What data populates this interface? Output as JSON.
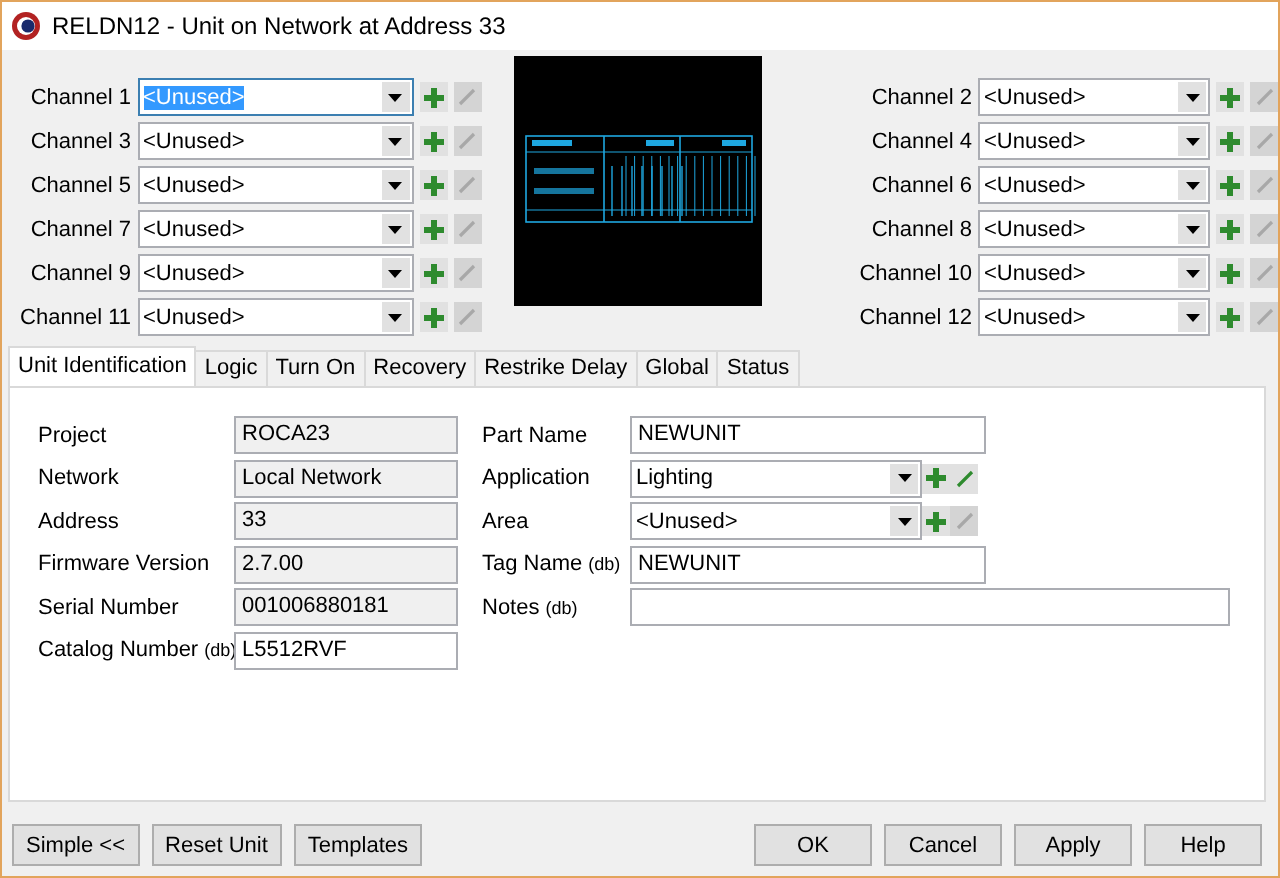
{
  "window": {
    "title": "RELDN12 - Unit on Network at Address 33"
  },
  "left_channels": [
    {
      "label": "Channel 1",
      "value": "<Unused>",
      "focused": true,
      "edit_enabled": false
    },
    {
      "label": "Channel 3",
      "value": "<Unused>",
      "focused": false,
      "edit_enabled": false
    },
    {
      "label": "Channel 5",
      "value": "<Unused>",
      "focused": false,
      "edit_enabled": false
    },
    {
      "label": "Channel 7",
      "value": "<Unused>",
      "focused": false,
      "edit_enabled": false
    },
    {
      "label": "Channel 9",
      "value": "<Unused>",
      "focused": false,
      "edit_enabled": false
    },
    {
      "label": "Channel 11",
      "value": "<Unused>",
      "focused": false,
      "edit_enabled": false
    }
  ],
  "right_channels": [
    {
      "label": "Channel 2",
      "value": "<Unused>",
      "focused": false,
      "edit_enabled": false
    },
    {
      "label": "Channel 4",
      "value": "<Unused>",
      "focused": false,
      "edit_enabled": false
    },
    {
      "label": "Channel 6",
      "value": "<Unused>",
      "focused": false,
      "edit_enabled": false
    },
    {
      "label": "Channel 8",
      "value": "<Unused>",
      "focused": false,
      "edit_enabled": false
    },
    {
      "label": "Channel 10",
      "value": "<Unused>",
      "focused": false,
      "edit_enabled": false
    },
    {
      "label": "Channel 12",
      "value": "<Unused>",
      "focused": false,
      "edit_enabled": false
    }
  ],
  "tabs": [
    {
      "label": "Unit Identification",
      "selected": true
    },
    {
      "label": "Logic",
      "selected": false
    },
    {
      "label": "Turn On",
      "selected": false
    },
    {
      "label": "Recovery",
      "selected": false
    },
    {
      "label": "Restrike Delay",
      "selected": false
    },
    {
      "label": "Global",
      "selected": false
    },
    {
      "label": "Status",
      "selected": false
    }
  ],
  "left_fields": [
    {
      "kind": "text",
      "label": "Project",
      "value": "ROCA23",
      "readonly": true
    },
    {
      "kind": "text",
      "label": "Network",
      "value": "Local Network",
      "readonly": true
    },
    {
      "kind": "text",
      "label": "Address",
      "value": "33",
      "readonly": true
    },
    {
      "kind": "text",
      "label": "Firmware Version",
      "value": "2.7.00",
      "readonly": true
    },
    {
      "kind": "text",
      "label": "Serial Number",
      "value": "001006880181",
      "readonly": true
    },
    {
      "kind": "text",
      "label": "Catalog Number",
      "suffix": "(db)",
      "value": "L5512RVF",
      "readonly": false
    }
  ],
  "right_fields": [
    {
      "kind": "text",
      "label": "Part Name",
      "value": "NEWUNIT",
      "readonly": false
    },
    {
      "kind": "combo",
      "label": "Application",
      "value": "Lighting",
      "edit_enabled": true
    },
    {
      "kind": "combo",
      "label": "Area",
      "value": "<Unused>",
      "edit_enabled": false
    },
    {
      "kind": "text",
      "label": "Tag Name",
      "suffix": "(db)",
      "value": "NEWUNIT",
      "readonly": false
    },
    {
      "kind": "wide",
      "label": "Notes",
      "suffix": "(db)",
      "readonly": false
    }
  ],
  "left_buttons": [
    "Simple <<",
    "Reset Unit",
    "Templates"
  ],
  "right_buttons": [
    "OK",
    "Cancel",
    "Apply",
    "Help"
  ]
}
